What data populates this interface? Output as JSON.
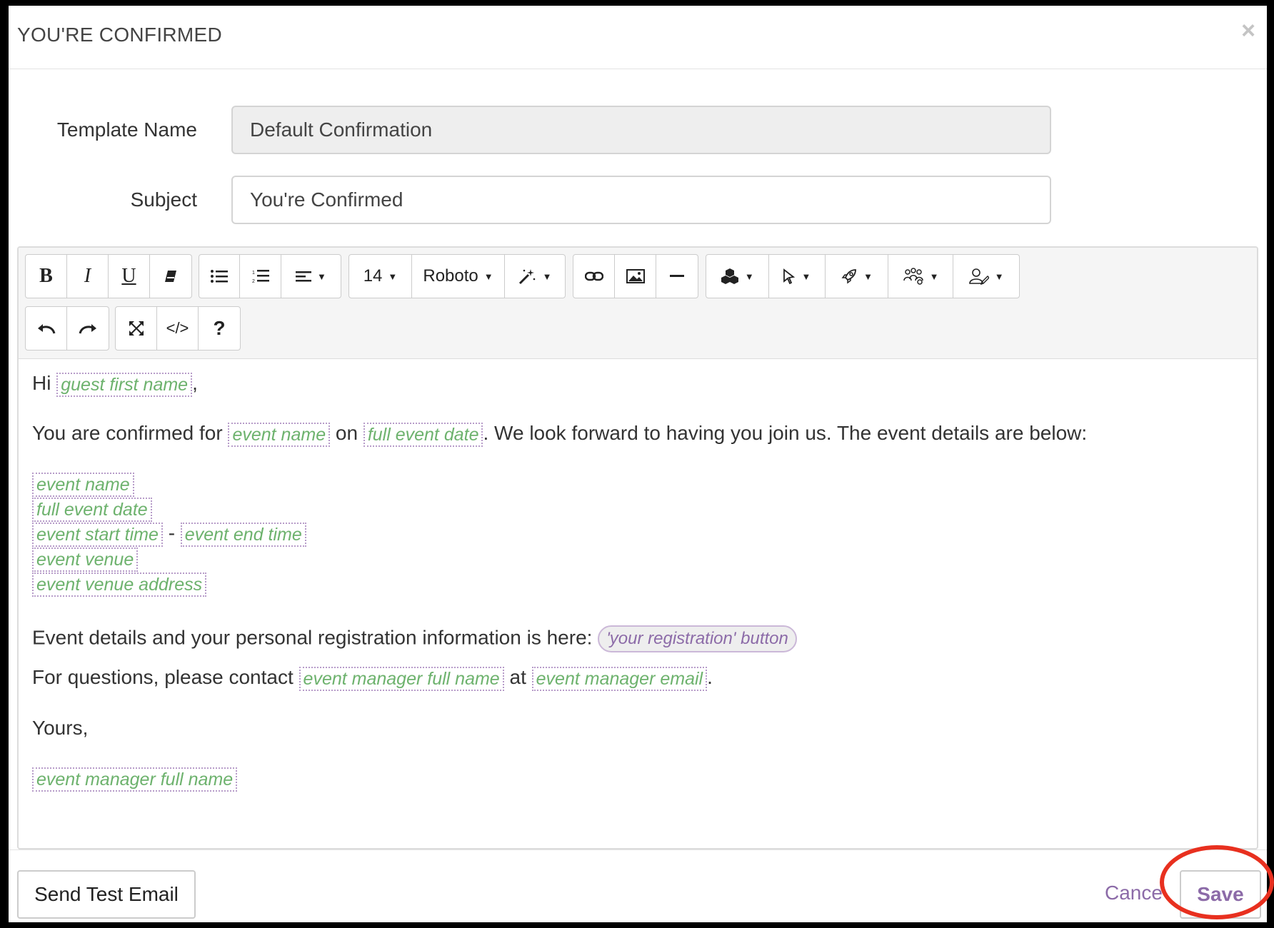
{
  "modal": {
    "title": "YOU'RE CONFIRMED",
    "close_symbol": "×"
  },
  "form": {
    "template_label": "Template Name",
    "template_value": "Default Confirmation",
    "subject_label": "Subject",
    "subject_value": "You're Confirmed"
  },
  "toolbar": {
    "font_size": "14",
    "font_family": "Roboto",
    "caret": "▼",
    "icons": [
      "bold-icon",
      "italic-icon",
      "underline-icon",
      "eraser-icon",
      "bullet-list-icon",
      "numbered-list-icon",
      "align-icon",
      "magic-wand-icon",
      "link-icon",
      "image-icon",
      "horizontal-rule-icon",
      "cubes-icon",
      "cursor-icon",
      "rocket-icon",
      "group-icon",
      "user-icon",
      "undo-icon",
      "redo-icon",
      "fullscreen-icon",
      "code-view-icon",
      "help-icon"
    ],
    "bold": "B",
    "italic": "I",
    "underline": "U",
    "code": "</>",
    "help": "?"
  },
  "body": {
    "greeting": "Hi",
    "greeting_end": ",",
    "tag_guest_first_name": "guest first name",
    "confirmed_text": "You are confirmed for",
    "on_text": "on",
    "look_forward_text": ". We look forward to having you join us. The event details are below:",
    "tag_event_name": "event name",
    "tag_full_event_date": "full event date",
    "tag_event_start_time": "event start time",
    "dash": "-",
    "tag_event_end_time": "event end time",
    "tag_event_venue": "event venue",
    "tag_event_venue_address": "event venue address",
    "registration_text": "Event details and your personal registration information is here:",
    "registration_button": "'your registration' button",
    "questions_text": "For questions, please contact",
    "at_text": "at",
    "tag_event_manager_full_name": "event manager full name",
    "tag_event_manager_email": "event manager email",
    "period": ".",
    "signoff": "Yours,"
  },
  "footer": {
    "send_test_label": "Send Test Email",
    "cancel_label": "Cance",
    "save_label": "Save"
  },
  "colors": {
    "accent": "#8c6ba8",
    "tag_text": "#6db26d",
    "highlight": "#e8301f"
  }
}
